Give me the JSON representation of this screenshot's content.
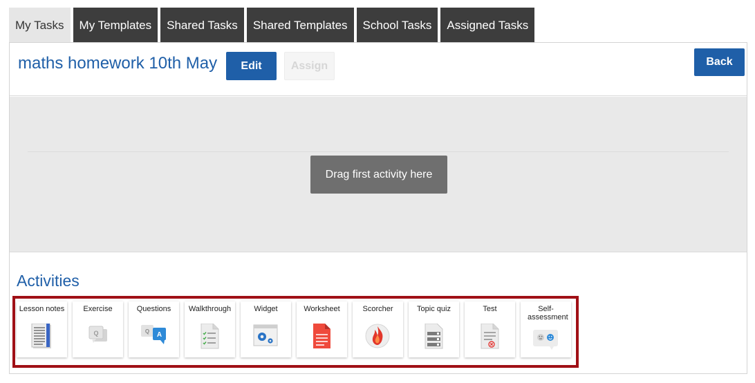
{
  "tabs": [
    "My Tasks",
    "My Templates",
    "Shared Tasks",
    "Shared Templates",
    "School Tasks",
    "Assigned Tasks"
  ],
  "task": {
    "title": "maths homework 10th May",
    "edit_label": "Edit",
    "assign_label": "Assign",
    "back_label": "Back"
  },
  "dropzone": {
    "hint": "Drag first activity here"
  },
  "activities": {
    "title": "Activities",
    "items": [
      {
        "label": "Lesson notes",
        "icon": "lesson-notes-icon"
      },
      {
        "label": "Exercise",
        "icon": "exercise-icon"
      },
      {
        "label": "Questions",
        "icon": "questions-icon"
      },
      {
        "label": "Walkthrough",
        "icon": "walkthrough-icon"
      },
      {
        "label": "Widget",
        "icon": "widget-icon"
      },
      {
        "label": "Worksheet",
        "icon": "worksheet-icon"
      },
      {
        "label": "Scorcher",
        "icon": "scorcher-icon"
      },
      {
        "label": "Topic quiz",
        "icon": "topic-quiz-icon"
      },
      {
        "label": "Test",
        "icon": "test-icon"
      },
      {
        "label": "Self-assessment",
        "icon": "self-assessment-icon"
      }
    ]
  },
  "colors": {
    "brand_blue": "#1f5fa8",
    "tab_dark": "#3d3d3d",
    "tab_active": "#e6e6e6",
    "highlight_red": "#a01016"
  }
}
